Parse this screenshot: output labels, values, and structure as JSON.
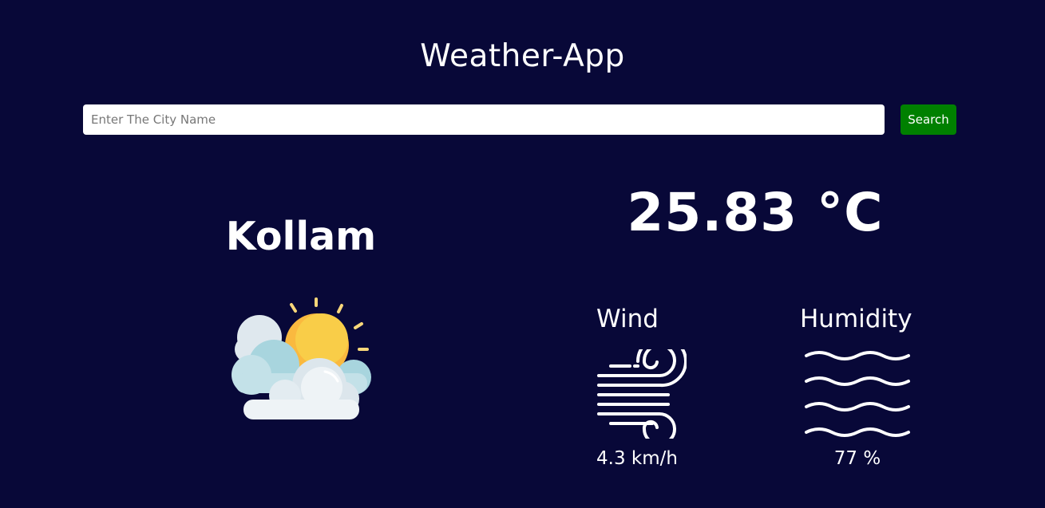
{
  "app": {
    "title": "Weather-App"
  },
  "search": {
    "placeholder": "Enter The City Name",
    "value": "",
    "button_label": "Search"
  },
  "weather": {
    "city": "Kollam",
    "condition_icon": "partly-cloudy-sun-icon",
    "temperature": "25.83 °C",
    "wind": {
      "label": "Wind",
      "icon": "wind-icon",
      "value": "4.3 km/h"
    },
    "humidity": {
      "label": "Humidity",
      "icon": "humidity-waves-icon",
      "value": "77 %"
    }
  },
  "colors": {
    "background": "#080838",
    "text": "#ffffff",
    "search_button": "#008000",
    "input_background": "#ffffff"
  }
}
